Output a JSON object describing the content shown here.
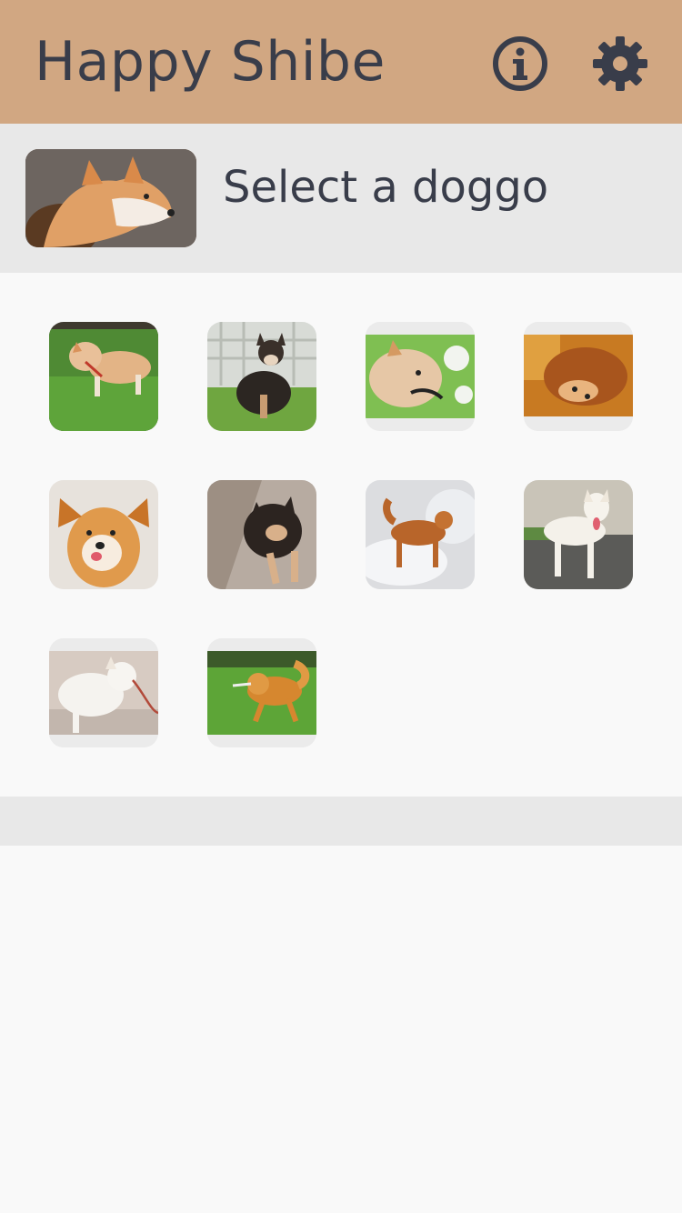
{
  "header": {
    "title": "Happy Shibe",
    "info_icon": "info-circle-icon",
    "settings_icon": "gear-icon",
    "background_color": "#d1a782",
    "text_color": "#393d4a"
  },
  "selection": {
    "prompt": "Select a doggo",
    "thumbnail": "shiba-portrait-photo"
  },
  "gallery": {
    "items": [
      {
        "subject": "shiba-red-on-grass"
      },
      {
        "subject": "shiba-black-tan-sitting"
      },
      {
        "subject": "shiba-closeup-leaves"
      },
      {
        "subject": "shiba-lying-wood-floor"
      },
      {
        "subject": "shiba-puppy-smiling"
      },
      {
        "subject": "shiba-black-tan-lying"
      },
      {
        "subject": "shiba-red-in-snow"
      },
      {
        "subject": "shiba-cream-on-path"
      },
      {
        "subject": "shiba-cream-with-leash"
      },
      {
        "subject": "shiba-red-running-grass"
      }
    ]
  }
}
